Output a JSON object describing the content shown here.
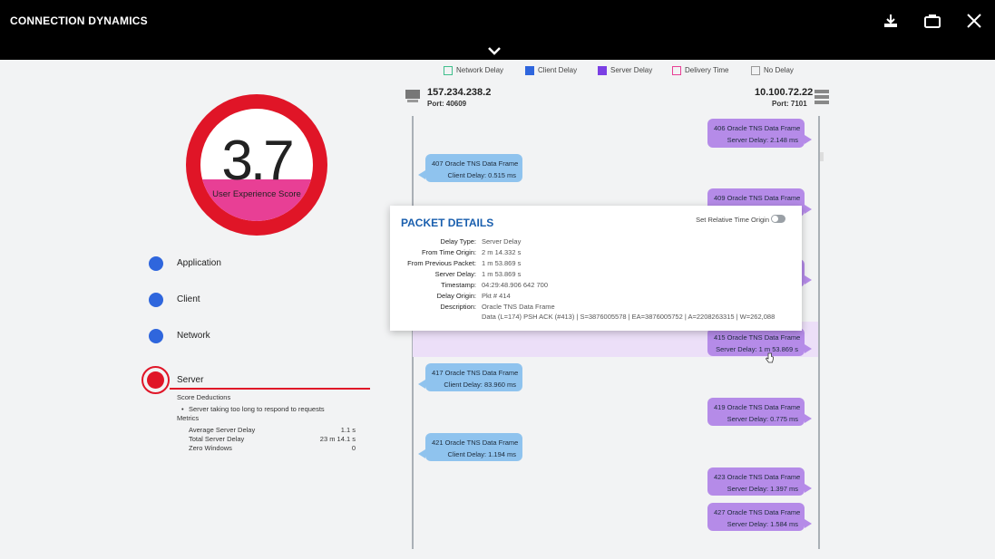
{
  "header": {
    "title": "CONNECTION DYNAMICS"
  },
  "legend": [
    {
      "label": "Network Delay",
      "color": "#3fbf8c",
      "style": "outline"
    },
    {
      "label": "Client Delay",
      "color": "#2f66dd",
      "style": "filled"
    },
    {
      "label": "Server Delay",
      "color": "#7b3fe4",
      "style": "filled"
    },
    {
      "label": "Delivery Time",
      "color": "#e83f95",
      "style": "outline"
    },
    {
      "label": "No Delay",
      "color": "#999999",
      "style": "outline"
    }
  ],
  "client_host": {
    "ip": "157.234.238.2",
    "port": "Port: 40609"
  },
  "server_host": {
    "ip": "10.100.72.22",
    "port": "Port: 7101"
  },
  "score": {
    "value": "3.7",
    "label": "User Experience Score",
    "fill_fraction": 0.37
  },
  "categories": [
    {
      "name": "Application"
    },
    {
      "name": "Client"
    },
    {
      "name": "Network"
    }
  ],
  "server": {
    "name": "Server",
    "deductions_title": "Score Deductions",
    "deduction": "Server taking too long to respond to requests",
    "metrics_title": "Metrics",
    "metrics": [
      {
        "label": "Average Server Delay",
        "value": "1.1 s"
      },
      {
        "label": "Total Server Delay",
        "value": "23 m 14.1 s"
      },
      {
        "label": "Zero Windows",
        "value": "0"
      }
    ]
  },
  "bubbles": [
    {
      "side": "s",
      "line1": "406   Oracle TNS Data Frame",
      "line2": "Server Delay:  2.148 ms"
    },
    {
      "side": "c",
      "line1": "407   Oracle TNS Data Frame",
      "line2": "Client Delay:  0.515 ms"
    },
    {
      "side": "s",
      "line1": "409   Oracle TNS Data Frame",
      "line2": ""
    },
    {
      "side": "s",
      "line1": "",
      "line2": ""
    },
    {
      "side": "s",
      "line1": "415   Oracle TNS Data Frame",
      "line2": "Server Delay:  1 m 53.869 s"
    },
    {
      "side": "c",
      "line1": "417   Oracle TNS Data Frame",
      "line2": "Client Delay:  83.960 ms"
    },
    {
      "side": "s",
      "line1": "419   Oracle TNS Data Frame",
      "line2": "Server Delay:  0.775 ms"
    },
    {
      "side": "c",
      "line1": "421   Oracle TNS Data Frame",
      "line2": "Client Delay:  1.194 ms"
    },
    {
      "side": "s",
      "line1": "423   Oracle TNS Data Frame",
      "line2": "Server Delay:  1.397 ms"
    },
    {
      "side": "s",
      "line1": "427   Oracle TNS Data Frame",
      "line2": "Server Delay:  1.584 ms"
    }
  ],
  "details": {
    "title": "PACKET DETAILS",
    "toggle_label": "Set Relative Time Origin",
    "rows": [
      {
        "k": "Delay Type:",
        "v": "Server Delay"
      },
      {
        "k": "From Time Origin:",
        "v": "2 m 14.332 s"
      },
      {
        "k": "From Previous Packet:",
        "v": "1 m 53.869 s"
      },
      {
        "k": "Server Delay:",
        "v": "1 m 53.869 s"
      },
      {
        "k": "Timestamp:",
        "v": "04:29:48.906 642 700"
      },
      {
        "k": "Delay Origin:",
        "v": "Pkt # 414"
      },
      {
        "k": "Description:",
        "v": "Oracle TNS Data Frame"
      },
      {
        "k": "",
        "v": "Data (L=174) PSH ACK (#413) | S=3876005578 | EA=3876005752 | A=2208263315 | W=262,088"
      }
    ]
  }
}
